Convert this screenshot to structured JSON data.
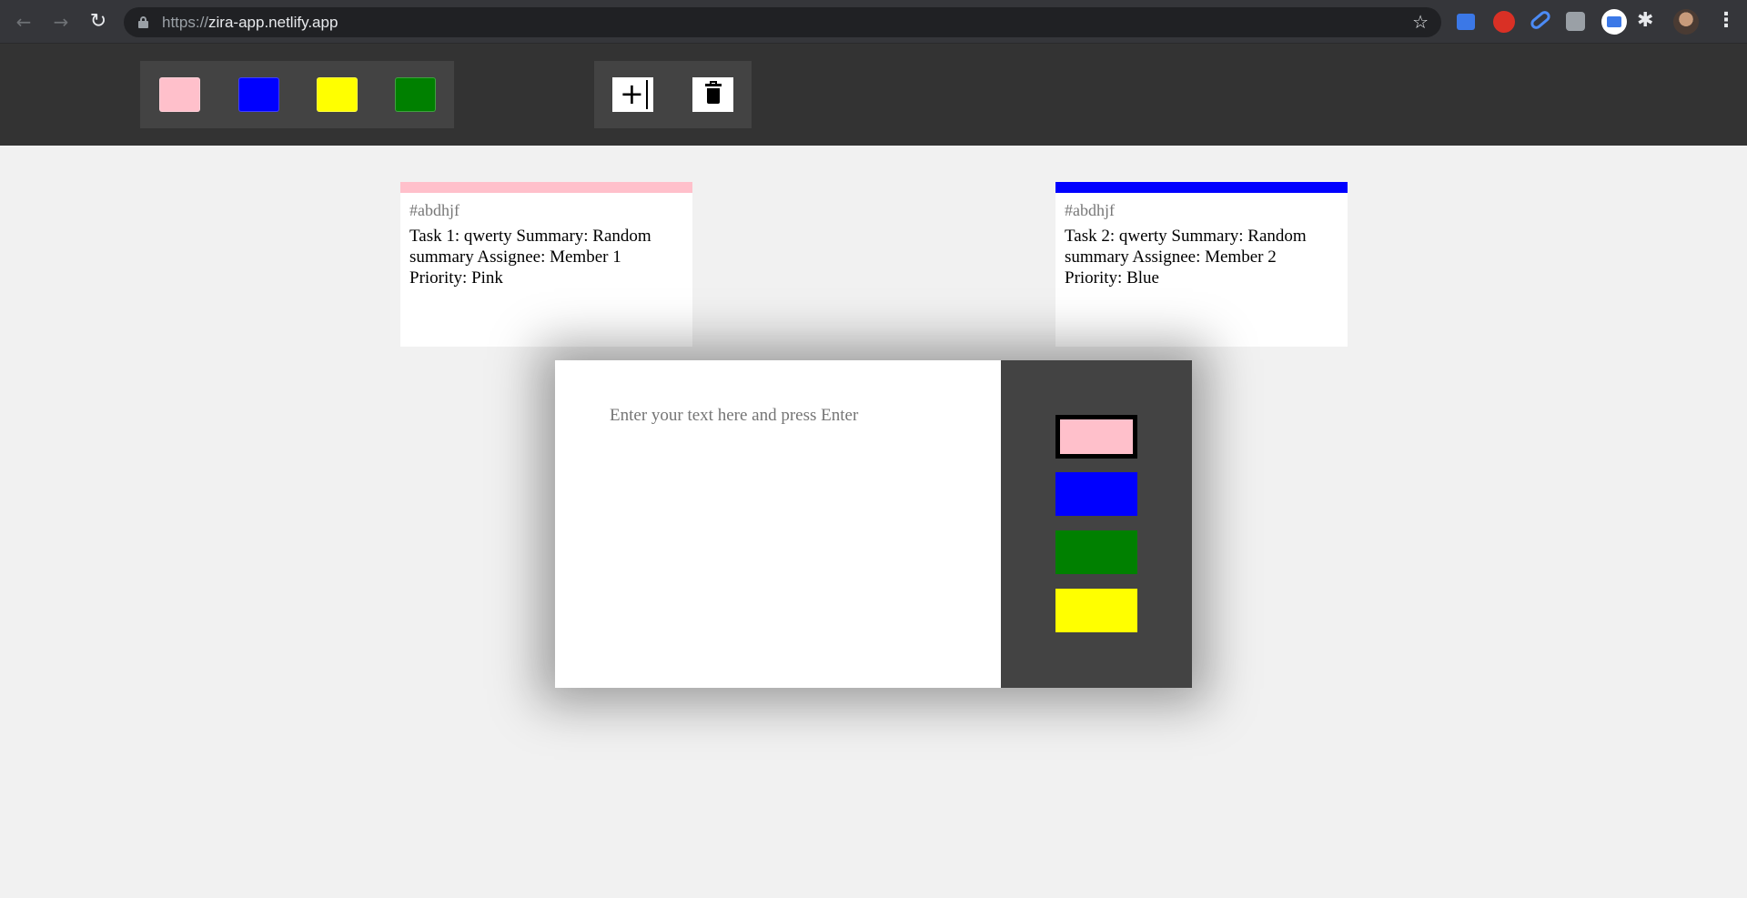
{
  "browser": {
    "url_scheme": "https://",
    "url_host": "zira-app.netlify.app",
    "icons": {
      "back": "arrow-left-icon",
      "forward": "arrow-right-icon",
      "reload": "reload-icon",
      "lock": "lock-icon",
      "bookmark": "star-icon",
      "extensions": "puzzle-icon",
      "menu": "kebab-menu-icon"
    }
  },
  "toolbar": {
    "filter_colors": [
      "#ffc0cb",
      "#0000ff",
      "#ffff00",
      "#008000"
    ],
    "filter_color_names": [
      "pink",
      "blue",
      "yellow",
      "green"
    ],
    "add_symbol": "+",
    "icons": {
      "add": "plus-icon",
      "delete": "trash-icon"
    }
  },
  "tickets": [
    {
      "color": "#ffc0cb",
      "id": "#abdhjf",
      "text": "Task 1: qwerty Summary: Random summary Assignee: Member 1 Priority: Pink"
    },
    {
      "color": "#0000ff",
      "id": "#abdhjf",
      "text": "Task 2: qwerty Summary: Random summary Assignee: Member 2 Priority: Blue"
    }
  ],
  "modal": {
    "placeholder": "Enter your text here and press Enter",
    "value": "",
    "priority_colors": [
      "#ffc0cb",
      "#0000ff",
      "#008000",
      "#ffff00"
    ],
    "priority_names": [
      "pink",
      "blue",
      "green",
      "yellow"
    ],
    "selected_priority": "pink"
  }
}
